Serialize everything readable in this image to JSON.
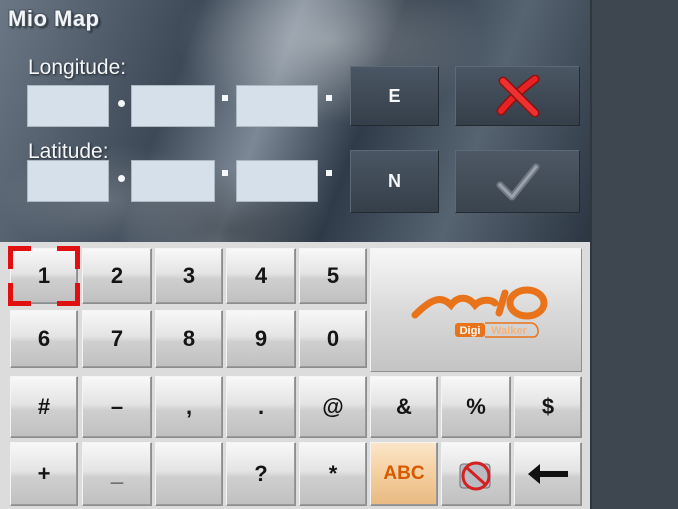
{
  "app": {
    "title": "Mio Map"
  },
  "form": {
    "longitude_label": "Longitude:",
    "latitude_label": "Latitude:",
    "longitude": {
      "deg": "",
      "min": "",
      "sec": "",
      "direction": "E"
    },
    "latitude": {
      "deg": "",
      "min": "",
      "sec": "",
      "direction": "N"
    }
  },
  "actions": {
    "cancel_icon": "red-x-icon",
    "confirm_icon": "checkmark-icon"
  },
  "keypad": {
    "row1": [
      "1",
      "2",
      "3",
      "4",
      "5"
    ],
    "row2": [
      "6",
      "7",
      "8",
      "9",
      "0"
    ],
    "row3": [
      "#",
      "–",
      ",",
      ".",
      "@",
      "&",
      "%",
      "$"
    ],
    "row4": [
      "+",
      "_",
      "",
      "?",
      "*",
      "ABC"
    ],
    "selected_key": "1",
    "special_icons": [
      "no-symbol-icon",
      "backspace-arrow-icon"
    ]
  },
  "logo": {
    "brand": "mio",
    "sub_left": "Digi",
    "sub_right": "Walker"
  },
  "colors": {
    "accent_orange": "#e8731a",
    "selection_red": "#e01010"
  }
}
